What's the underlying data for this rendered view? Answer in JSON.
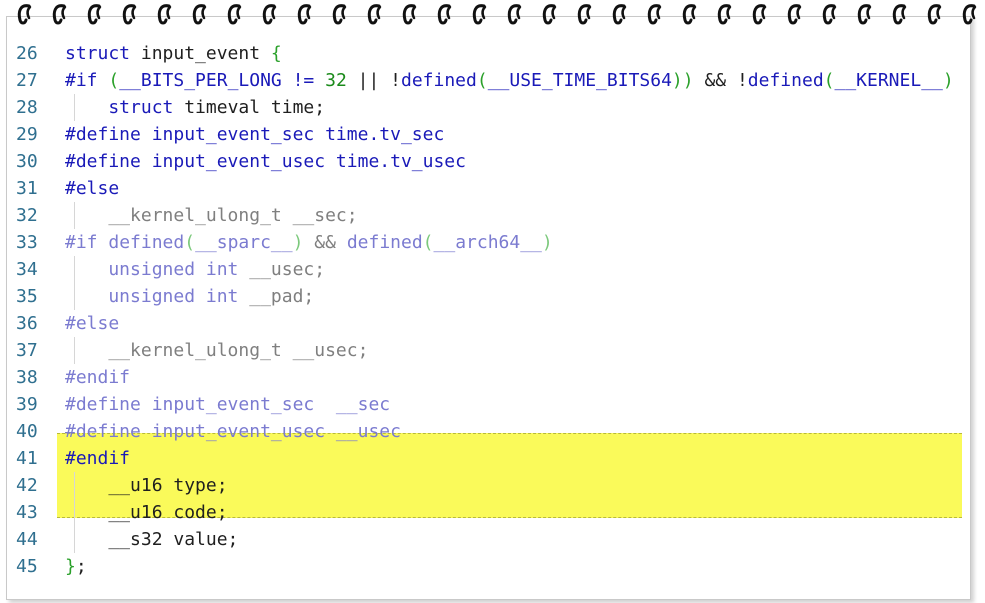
{
  "lines": [
    {
      "n": "26",
      "tokens": [
        {
          "t": "struct ",
          "c": "kw"
        },
        {
          "t": "input_event ",
          "c": ""
        },
        {
          "t": "{",
          "c": "grn"
        }
      ]
    },
    {
      "n": "27",
      "tokens": [
        {
          "t": "#if ",
          "c": "pp"
        },
        {
          "t": "(",
          "c": "grn"
        },
        {
          "t": "__BITS_PER_LONG != ",
          "c": "kw"
        },
        {
          "t": "32",
          "c": "num"
        },
        {
          "t": " || !",
          "c": ""
        },
        {
          "t": "defined",
          "c": "kw"
        },
        {
          "t": "(",
          "c": "grn"
        },
        {
          "t": "__USE_TIME_BITS64",
          "c": "kw"
        },
        {
          "t": "))",
          "c": "grn"
        },
        {
          "t": " && !",
          "c": ""
        },
        {
          "t": "defined",
          "c": "kw"
        },
        {
          "t": "(",
          "c": "grn"
        },
        {
          "t": "__KERNEL__",
          "c": "kw"
        },
        {
          "t": ")",
          "c": "grn"
        }
      ]
    },
    {
      "n": "28",
      "guide": true,
      "tokens": [
        {
          "t": "    struct ",
          "c": "kw"
        },
        {
          "t": "timeval time;",
          "c": ""
        }
      ]
    },
    {
      "n": "29",
      "tokens": [
        {
          "t": "#define ",
          "c": "pp"
        },
        {
          "t": "input_event_sec time.tv_sec",
          "c": "kw"
        }
      ]
    },
    {
      "n": "30",
      "tokens": [
        {
          "t": "#define ",
          "c": "pp"
        },
        {
          "t": "input_event_usec time.tv_usec",
          "c": "kw"
        }
      ]
    },
    {
      "n": "31",
      "tokens": [
        {
          "t": "#else",
          "c": "pp"
        }
      ]
    },
    {
      "n": "32",
      "guide": true,
      "tokens": [
        {
          "t": "    __kernel_ulong_t __sec;",
          "c": "dim"
        }
      ]
    },
    {
      "n": "33",
      "tokens": [
        {
          "t": "#if ",
          "c": "dimkw"
        },
        {
          "t": "defined",
          "c": "dimkw"
        },
        {
          "t": "(",
          "c": "dimgrn"
        },
        {
          "t": "__sparc__",
          "c": "dimkw"
        },
        {
          "t": ")",
          "c": "dimgrn"
        },
        {
          "t": " && ",
          "c": "dim"
        },
        {
          "t": "defined",
          "c": "dimkw"
        },
        {
          "t": "(",
          "c": "dimgrn"
        },
        {
          "t": "__arch64__",
          "c": "dimkw"
        },
        {
          "t": ")",
          "c": "dimgrn"
        }
      ]
    },
    {
      "n": "34",
      "guide": true,
      "tokens": [
        {
          "t": "    unsigned int ",
          "c": "dimkw"
        },
        {
          "t": "__usec;",
          "c": "dim"
        }
      ]
    },
    {
      "n": "35",
      "guide": true,
      "tokens": [
        {
          "t": "    unsigned int ",
          "c": "dimkw"
        },
        {
          "t": "__pad;",
          "c": "dim"
        }
      ]
    },
    {
      "n": "36",
      "tokens": [
        {
          "t": "#else",
          "c": "dimkw"
        }
      ]
    },
    {
      "n": "37",
      "guide": true,
      "tokens": [
        {
          "t": "    __kernel_ulong_t __usec;",
          "c": "dim"
        }
      ]
    },
    {
      "n": "38",
      "tokens": [
        {
          "t": "#endif",
          "c": "dimkw"
        }
      ]
    },
    {
      "n": "39",
      "tokens": [
        {
          "t": "#define ",
          "c": "dimkw"
        },
        {
          "t": "input_event_sec  __sec",
          "c": "dimkw"
        }
      ]
    },
    {
      "n": "40",
      "tokens": [
        {
          "t": "#define ",
          "c": "dimkw"
        },
        {
          "t": "input_event_usec __usec",
          "c": "dimkw"
        }
      ]
    },
    {
      "n": "41",
      "tokens": [
        {
          "t": "#endif",
          "c": "pp"
        }
      ]
    },
    {
      "n": "42",
      "guide": true,
      "tokens": [
        {
          "t": "    __u16 type;",
          "c": ""
        }
      ]
    },
    {
      "n": "43",
      "guide": true,
      "tokens": [
        {
          "t": "    __u16 code;",
          "c": ""
        }
      ]
    },
    {
      "n": "44",
      "guide": true,
      "tokens": [
        {
          "t": "    __s32 value;",
          "c": ""
        }
      ]
    },
    {
      "n": "45",
      "tokens": [
        {
          "t": "}",
          "c": "grn"
        },
        {
          "t": ";",
          "c": ""
        }
      ]
    }
  ],
  "highlight": {
    "from_line": "42",
    "to_line": "44",
    "color": "#fafa5a"
  }
}
